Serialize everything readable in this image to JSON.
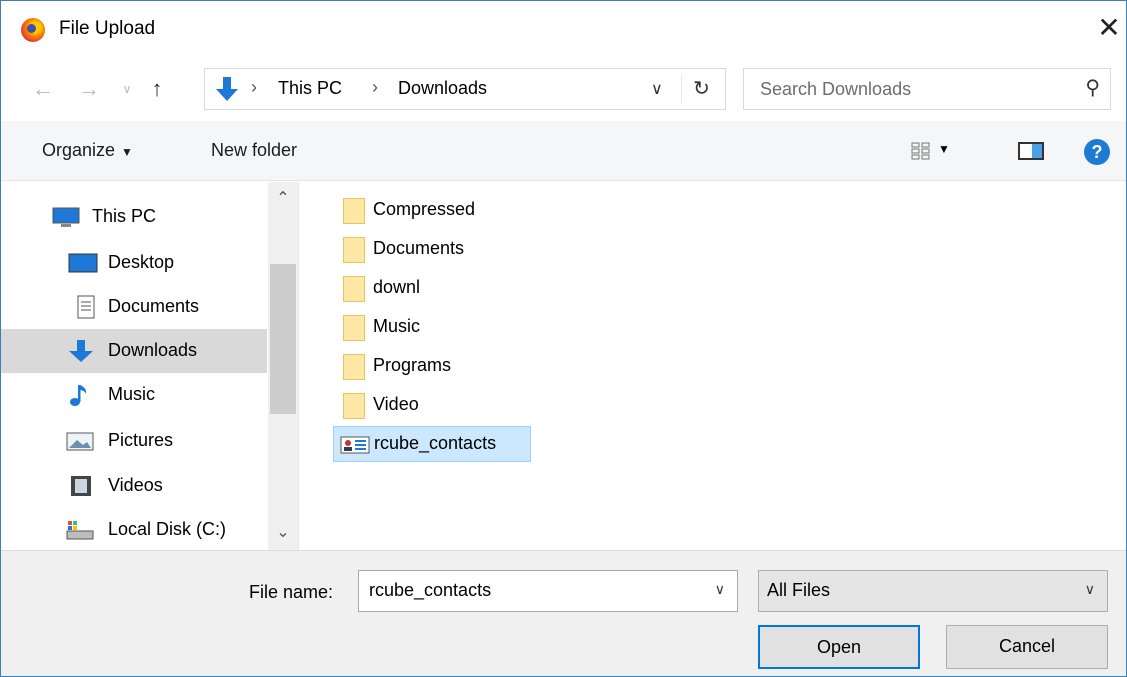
{
  "window": {
    "title": "File Upload",
    "close_icon": "close-icon"
  },
  "nav": {
    "breadcrumbs": [
      "This PC",
      "Downloads"
    ],
    "search_placeholder": "Search Downloads"
  },
  "toolbar": {
    "organize_label": "Organize",
    "new_folder_label": "New folder"
  },
  "sidebar": {
    "items": [
      {
        "label": "This PC",
        "icon": "computer-icon"
      },
      {
        "label": "Desktop",
        "icon": "desktop-icon"
      },
      {
        "label": "Documents",
        "icon": "documents-icon"
      },
      {
        "label": "Downloads",
        "icon": "downloads-icon",
        "selected": true
      },
      {
        "label": "Music",
        "icon": "music-icon"
      },
      {
        "label": "Pictures",
        "icon": "pictures-icon"
      },
      {
        "label": "Videos",
        "icon": "videos-icon"
      },
      {
        "label": "Local Disk (C:)",
        "icon": "drive-icon"
      }
    ]
  },
  "files": [
    {
      "name": "Compressed",
      "type": "folder"
    },
    {
      "name": "Documents",
      "type": "folder"
    },
    {
      "name": "downl",
      "type": "folder"
    },
    {
      "name": "Music",
      "type": "folder"
    },
    {
      "name": "Programs",
      "type": "folder"
    },
    {
      "name": "Video",
      "type": "folder"
    },
    {
      "name": "rcube_contacts",
      "type": "contact-file",
      "selected": true
    }
  ],
  "bottom": {
    "file_name_label": "File name:",
    "file_name_value": "rcube_contacts",
    "file_type_value": "All Files",
    "open_label": "Open",
    "cancel_label": "Cancel"
  },
  "colors": {
    "accent": "#0078d7",
    "selection": "#cce8ff",
    "folder": "#ffe8a6"
  }
}
